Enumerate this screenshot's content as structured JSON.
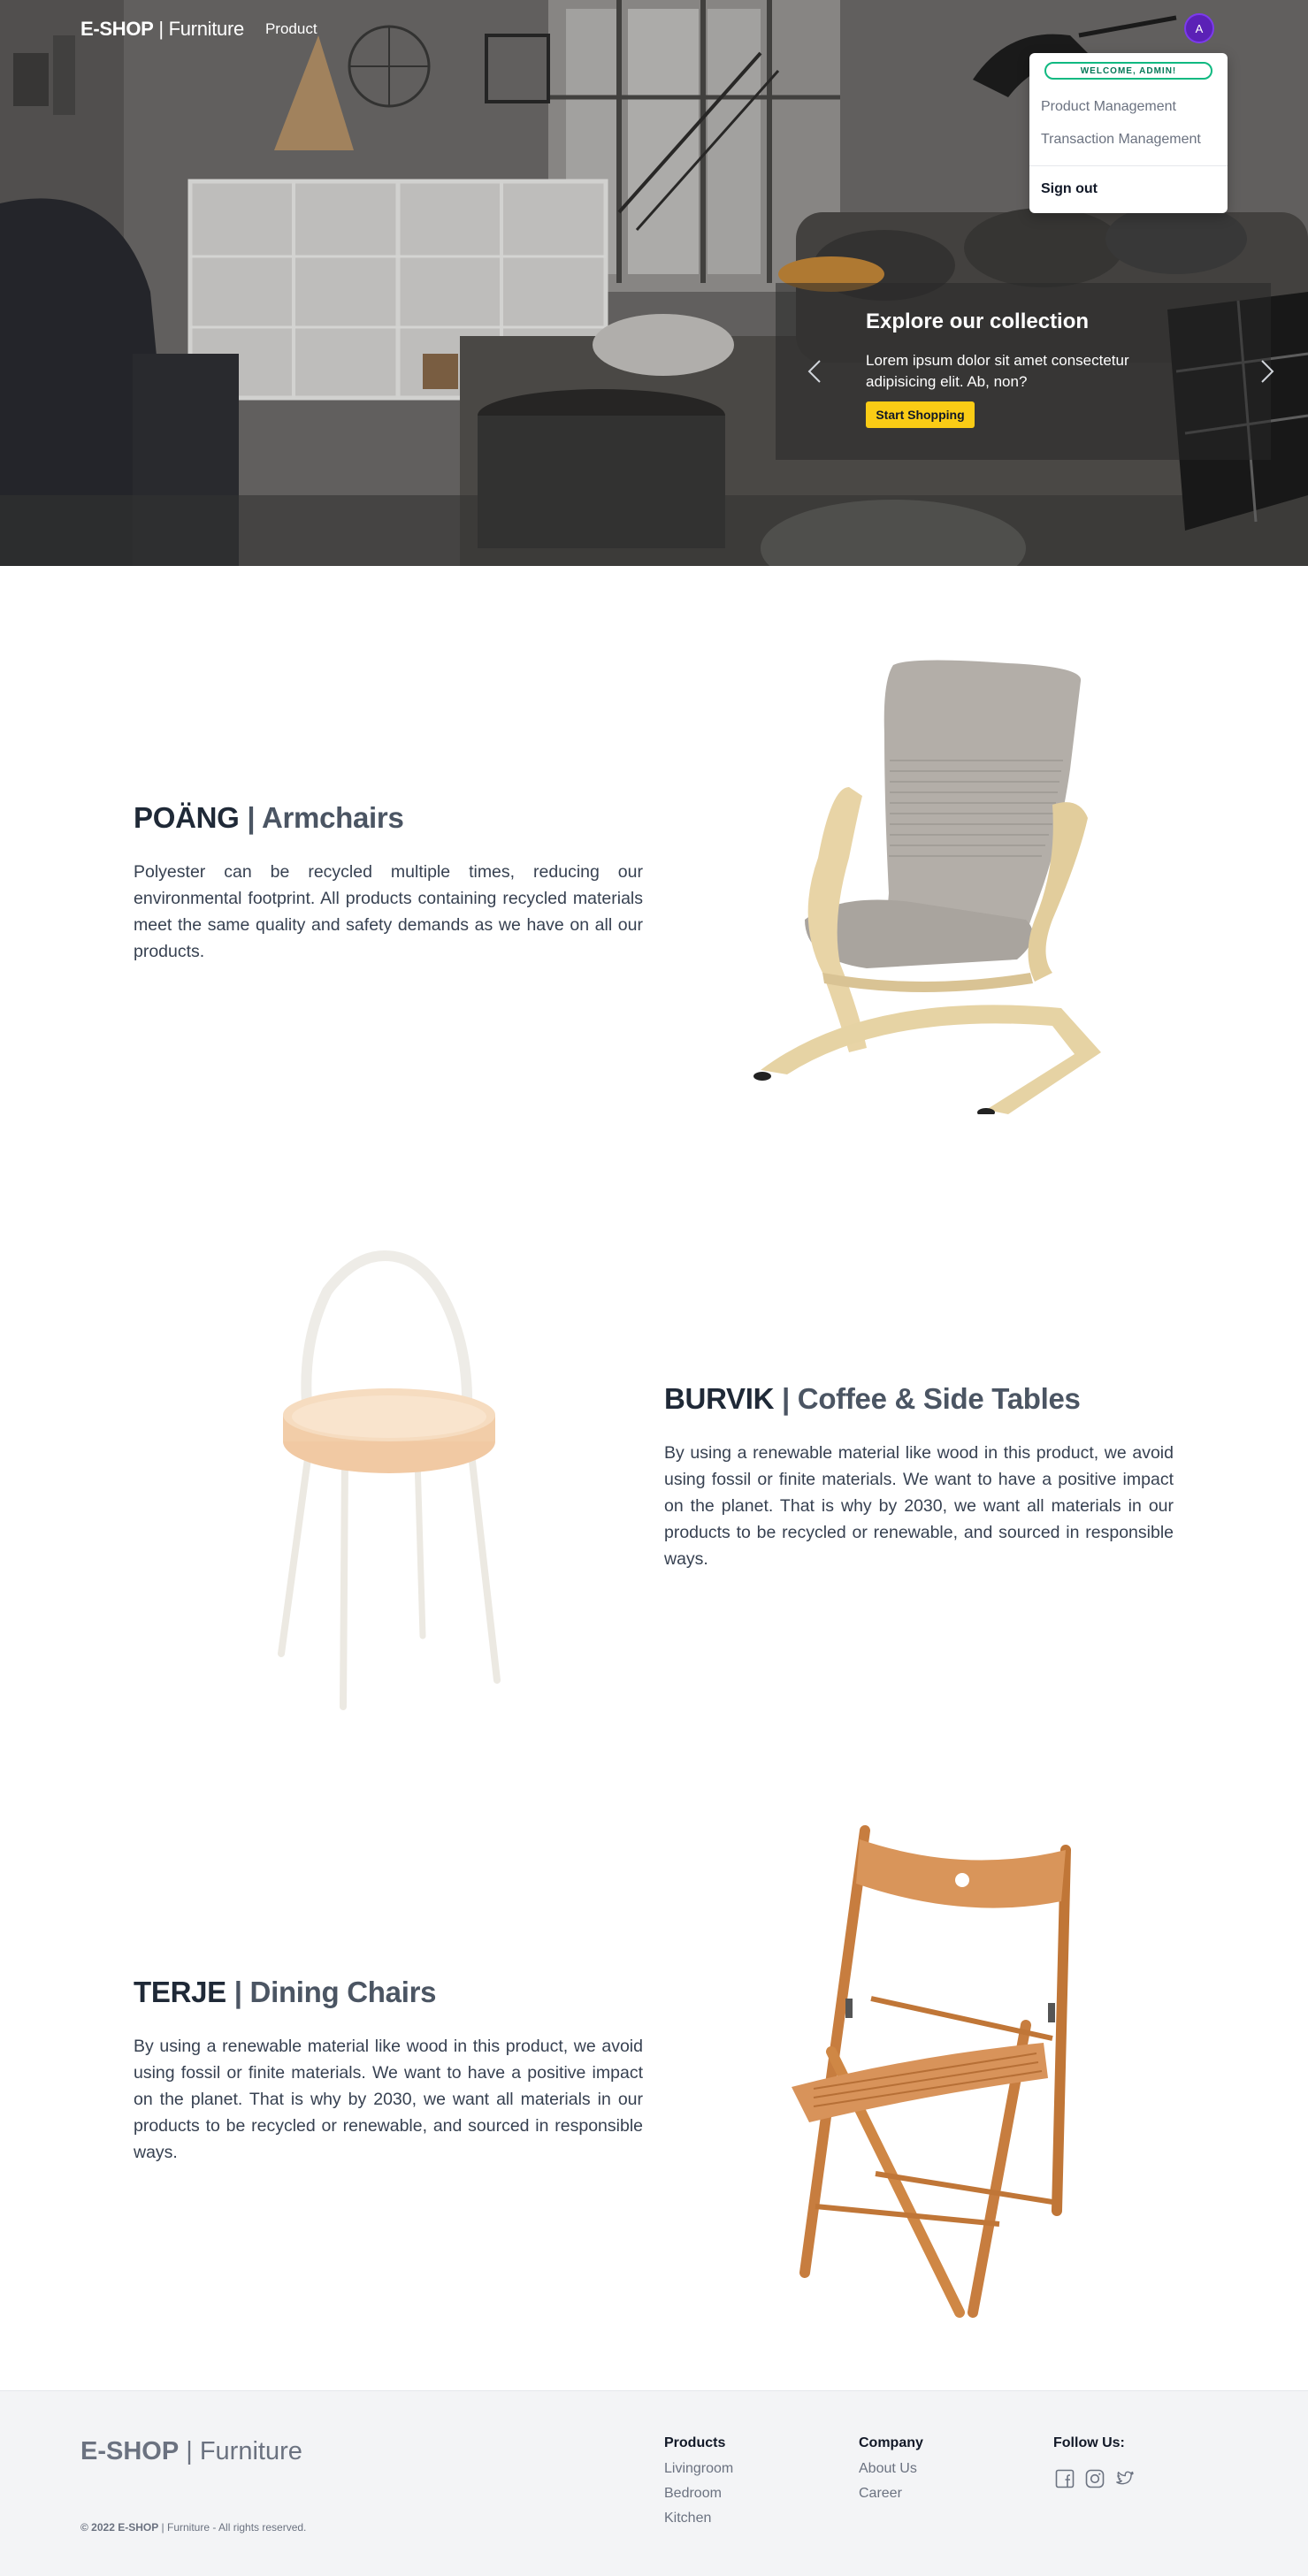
{
  "header": {
    "brand_bold": "E-SHOP",
    "brand_sep": " | ",
    "brand_light": "Furniture",
    "nav_product": "Product",
    "avatar_initial": "A"
  },
  "user_menu": {
    "welcome": "WELCOME, ADMIN!",
    "items": [
      "Product Management",
      "Transaction Management"
    ],
    "signout": "Sign out"
  },
  "hero": {
    "title": "Explore our collection",
    "text": "Lorem ipsum dolor sit amet consectetur adipisicing elit. Ab, non?",
    "cta": "Start Shopping",
    "prev_icon": "chevron-left-icon",
    "next_icon": "chevron-right-icon"
  },
  "features": [
    {
      "name": "POÄNG",
      "sep": " | ",
      "category": "Armchairs",
      "text": "Polyester can be recycled multiple times, reducing our environmental footprint. All products containing recycled materials meet the same quality and safety demands as we have on all our products."
    },
    {
      "name": "BURVIK",
      "sep": " | ",
      "category": "Coffee & Side Tables",
      "text": "By using a renewable material like wood in this product, we avoid using fossil or finite materials. We want to have a positive impact on the planet. That is why by 2030, we want all materials in our products to be recycled or renewable, and sourced in responsible ways."
    },
    {
      "name": "TERJE",
      "sep": " | ",
      "category": "Dining Chairs",
      "text": "By using a renewable material like wood in this product, we avoid using fossil or finite materials. We want to have a positive impact on the planet. That is why by 2030, we want all materials in our products to be recycled or renewable, and sourced in responsible ways."
    }
  ],
  "footer": {
    "brand_bold": "E-SHOP",
    "brand_sep": " | ",
    "brand_light": "Furniture",
    "copyright_bold": "© 2022 E-SHOP",
    "copyright_rest": " | Furniture - All rights reserved.",
    "products": {
      "title": "Products",
      "links": [
        "Livingroom",
        "Bedroom",
        "Kitchen"
      ]
    },
    "company": {
      "title": "Company",
      "links": [
        "About Us",
        "Career"
      ]
    },
    "follow": {
      "title": "Follow Us:",
      "icons": [
        "facebook-icon",
        "instagram-icon",
        "twitter-icon"
      ]
    }
  },
  "colors": {
    "accent_yellow": "#facc15",
    "avatar_purple": "#5b21b6",
    "welcome_green": "#10b981",
    "footer_bg": "#f3f4f6"
  }
}
